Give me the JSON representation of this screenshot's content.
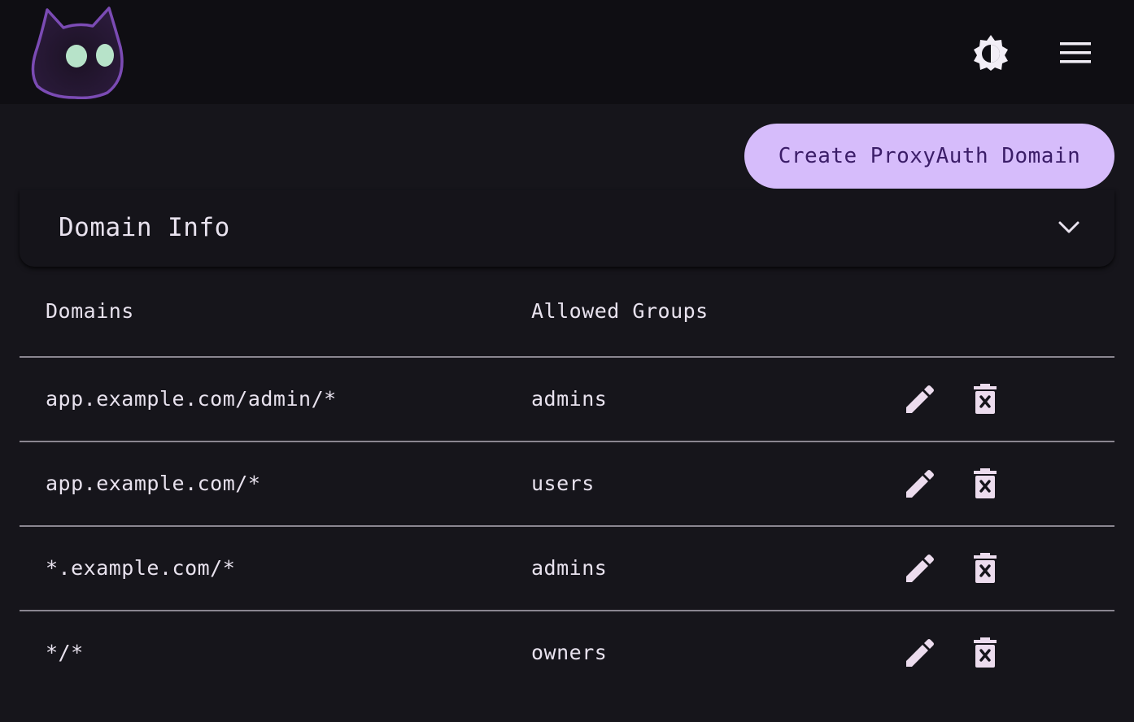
{
  "header": {
    "logo_icon": "cat-logo-icon",
    "theme_toggle_icon": "brightness-icon",
    "menu_icon": "hamburger-menu-icon"
  },
  "actions": {
    "create_label": "Create ProxyAuth Domain"
  },
  "accordion": {
    "title": "Domain Info",
    "icon": "chevron-down-icon"
  },
  "table": {
    "columns": [
      "Domains",
      "Allowed Groups"
    ],
    "rows": [
      {
        "domain": "app.example.com/admin/*",
        "group": "admins"
      },
      {
        "domain": "app.example.com/*",
        "group": "users"
      },
      {
        "domain": "*.example.com/*",
        "group": "admins"
      },
      {
        "domain": "*/*",
        "group": "owners"
      }
    ],
    "row_actions": [
      "edit-icon",
      "delete-icon"
    ]
  },
  "colors": {
    "background": "#16151b",
    "topbar": "#0f0e13",
    "accent": "#d6bcfb",
    "accent_text": "#3b1d68",
    "text": "#e8e2ee",
    "logo_outline": "#7b4bb4"
  }
}
